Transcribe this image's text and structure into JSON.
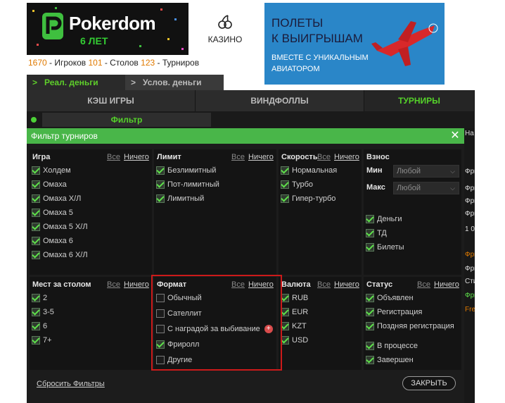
{
  "header": {
    "logo_name": "Pokerdom",
    "logo_age": "6 ЛЕТ",
    "casino_label": "КАЗИНО",
    "stats": [
      {
        "num": "1670",
        "label": " - Игроков "
      },
      {
        "num": "101",
        "label": " - Столов "
      },
      {
        "num": "123",
        "label": " - Турниров"
      }
    ],
    "banner": {
      "title_line1": "ПОЛЕТЫ",
      "title_line2": "К ВЫИГРЫШАМ",
      "sub_line1": "ВМЕСТЕ С УНИКАЛЬНЫМ",
      "sub_line2": "АВИАТОРОМ"
    }
  },
  "money_tabs": {
    "real": "Реал. деньги",
    "cond": "Услов. деньги"
  },
  "category_tabs": {
    "cash": "КЭШ ИГРЫ",
    "windfall": "ВИНДФОЛЛЫ",
    "tournaments": "ТУРНИРЫ"
  },
  "filter_bar": {
    "button": "Фильтр"
  },
  "right_strip": [
    "На",
    "Фри",
    "Фри",
    "Фри",
    "Фри",
    "1 0",
    "Фри",
    "Фри",
    "Сти",
    "Фри",
    "Free"
  ],
  "dialog": {
    "title": "Фильтр турниров",
    "all_label": "Все",
    "none_label": "Ничего",
    "reset": "Сбросить Фильтры",
    "close": "ЗАКРЫТЬ",
    "panels": {
      "game": {
        "title": "Игра",
        "items": [
          {
            "label": "Холдем",
            "checked": true
          },
          {
            "label": "Омаха",
            "checked": true
          },
          {
            "label": "Омаха Х/Л",
            "checked": true
          },
          {
            "label": "Омаха 5",
            "checked": true
          },
          {
            "label": "Омаха 5 Х/Л",
            "checked": true
          },
          {
            "label": "Омаха 6",
            "checked": true
          },
          {
            "label": "Омаха 6 Х/Л",
            "checked": true
          }
        ]
      },
      "limit": {
        "title": "Лимит",
        "items": [
          {
            "label": "Безлимитный",
            "checked": true
          },
          {
            "label": "Пот-лимитный",
            "checked": true
          },
          {
            "label": "Лимитный",
            "checked": true
          }
        ]
      },
      "speed": {
        "title": "Скорость",
        "items": [
          {
            "label": "Нормальная",
            "checked": true
          },
          {
            "label": "Турбо",
            "checked": true
          },
          {
            "label": "Гипер-турбо",
            "checked": true
          }
        ]
      },
      "buyin": {
        "title": "Взнос",
        "min_label": "Мин",
        "max_label": "Макс",
        "min_value": "Любой",
        "max_value": "Любой",
        "items": [
          {
            "label": "Деньги",
            "checked": true
          },
          {
            "label": "ТД",
            "checked": true
          },
          {
            "label": "Билеты",
            "checked": true
          }
        ]
      },
      "seats": {
        "title": "Мест за столом",
        "items": [
          {
            "label": "2",
            "checked": true
          },
          {
            "label": "3-5",
            "checked": true
          },
          {
            "label": "6",
            "checked": true
          },
          {
            "label": "7+",
            "checked": true
          }
        ]
      },
      "format": {
        "title": "Формат",
        "items": [
          {
            "label": "Обычный",
            "checked": false
          },
          {
            "label": "Сателлит",
            "checked": false
          },
          {
            "label": "С наградой за выбивание",
            "checked": false
          },
          {
            "label": "Фриролл",
            "checked": true
          },
          {
            "label": "Другие",
            "checked": false
          }
        ]
      },
      "currency": {
        "title": "Валюта",
        "items": [
          {
            "label": "RUB",
            "checked": true
          },
          {
            "label": "EUR",
            "checked": true
          },
          {
            "label": "KZT",
            "checked": true
          },
          {
            "label": "USD",
            "checked": true
          }
        ]
      },
      "status": {
        "title": "Статус",
        "items": [
          {
            "label": "Объявлен",
            "checked": true
          },
          {
            "label": "Регистрация",
            "checked": true
          },
          {
            "label": "Поздняя регистрация",
            "checked": true
          },
          {
            "label": "В процессе",
            "checked": true
          },
          {
            "label": "Завершен",
            "checked": true
          }
        ]
      }
    }
  },
  "colors": {
    "accent_green": "#49b649",
    "highlight_red": "#cc1a1a",
    "stat_orange": "#e07a00"
  }
}
